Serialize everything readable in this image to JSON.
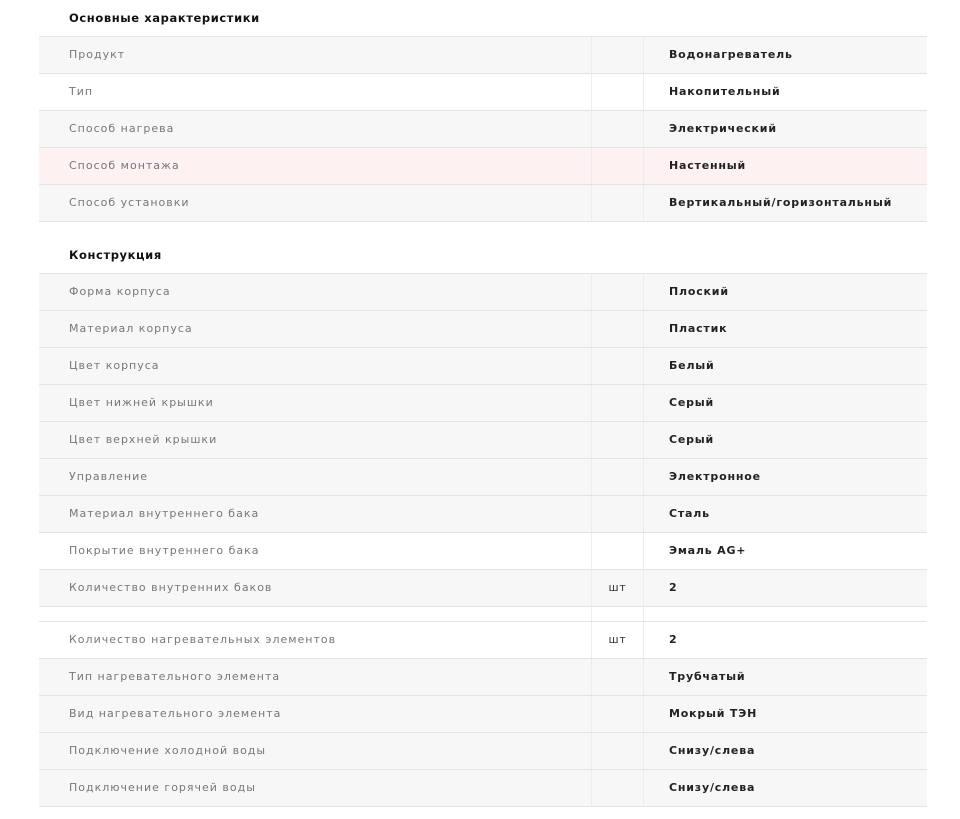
{
  "sections": [
    {
      "title": "Основные характеристики",
      "rows": [
        {
          "name": "Продукт",
          "unit": "",
          "value": "Водонагреватель"
        },
        {
          "name": "Тип",
          "unit": "",
          "value": "Накопительный"
        },
        {
          "name": "Способ нагрева",
          "unit": "",
          "value": "Электрический"
        },
        {
          "name": "Способ монтажа",
          "unit": "",
          "value": "Настенный"
        },
        {
          "name": "Способ установки",
          "unit": "",
          "value": "Вертикальный/горизонтальный"
        }
      ]
    },
    {
      "title": "Конструкция",
      "rows": [
        {
          "name": "Форма корпуса",
          "unit": "",
          "value": "Плоский"
        },
        {
          "name": "Материал корпуса",
          "unit": "",
          "value": "Пластик"
        },
        {
          "name": "Цвет корпуса",
          "unit": "",
          "value": "Белый"
        },
        {
          "name": "Цвет нижней крышки",
          "unit": "",
          "value": "Серый"
        },
        {
          "name": "Цвет верхней крышки",
          "unit": "",
          "value": "Серый"
        },
        {
          "name": "Управление",
          "unit": "",
          "value": "Электронное"
        },
        {
          "name": "Материал внутреннего бака",
          "unit": "",
          "value": "Сталь"
        },
        {
          "name": "Покрытие внутреннего бака",
          "unit": "",
          "value": "Эмаль AG+"
        },
        {
          "name": "Количество внутренних баков",
          "unit": "шт",
          "value": "2"
        },
        {
          "name": "Количество нагревательных элементов",
          "unit": "шт",
          "value": "2"
        },
        {
          "name": "Тип нагревательного элемента",
          "unit": "",
          "value": "Трубчатый"
        },
        {
          "name": "Вид нагревательного элемента",
          "unit": "",
          "value": "Мокрый ТЭН"
        },
        {
          "name": "Подключение холодной воды",
          "unit": "",
          "value": "Снизу/слева"
        },
        {
          "name": "Подключение горячей воды",
          "unit": "",
          "value": "Снизу/слева"
        }
      ]
    }
  ]
}
